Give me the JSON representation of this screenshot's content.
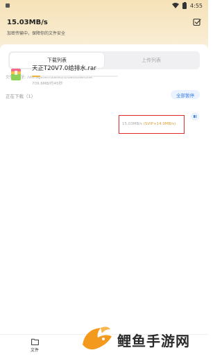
{
  "status_bar": {
    "time": "4:55"
  },
  "header": {
    "speed": "15.03MB/s",
    "subtitle": "加密传输中，保障你的文件安全"
  },
  "tabs": [
    {
      "label": "下载列表",
      "active": true
    },
    {
      "label": "上传列表",
      "active": false
    }
  ],
  "download_path": "文件下载至: /storage/emulated/0/BaiduNetdisk",
  "section": {
    "title": "正在下载（1）",
    "pause_all_label": "全部暂停"
  },
  "downloads": [
    {
      "name": "天正T20V7.0给排水.rar",
      "meta": "709.6MB/约45秒",
      "progress_percent": 10,
      "speed_base": "15.03MB/s",
      "speed_vip": "(SVIP+14.9MB/s)"
    }
  ],
  "bottom_nav": {
    "files_label": "文件"
  },
  "watermark": {
    "text": "鲤鱼手游网"
  },
  "colors": {
    "header_gradient_top": "#f6e2b8",
    "accent_blue": "#3a7de3",
    "progress": "#f0b13a",
    "vip_gold": "#d9a23a",
    "highlight_red": "#e02a2a",
    "watermark_orange": "#f39a1e"
  }
}
